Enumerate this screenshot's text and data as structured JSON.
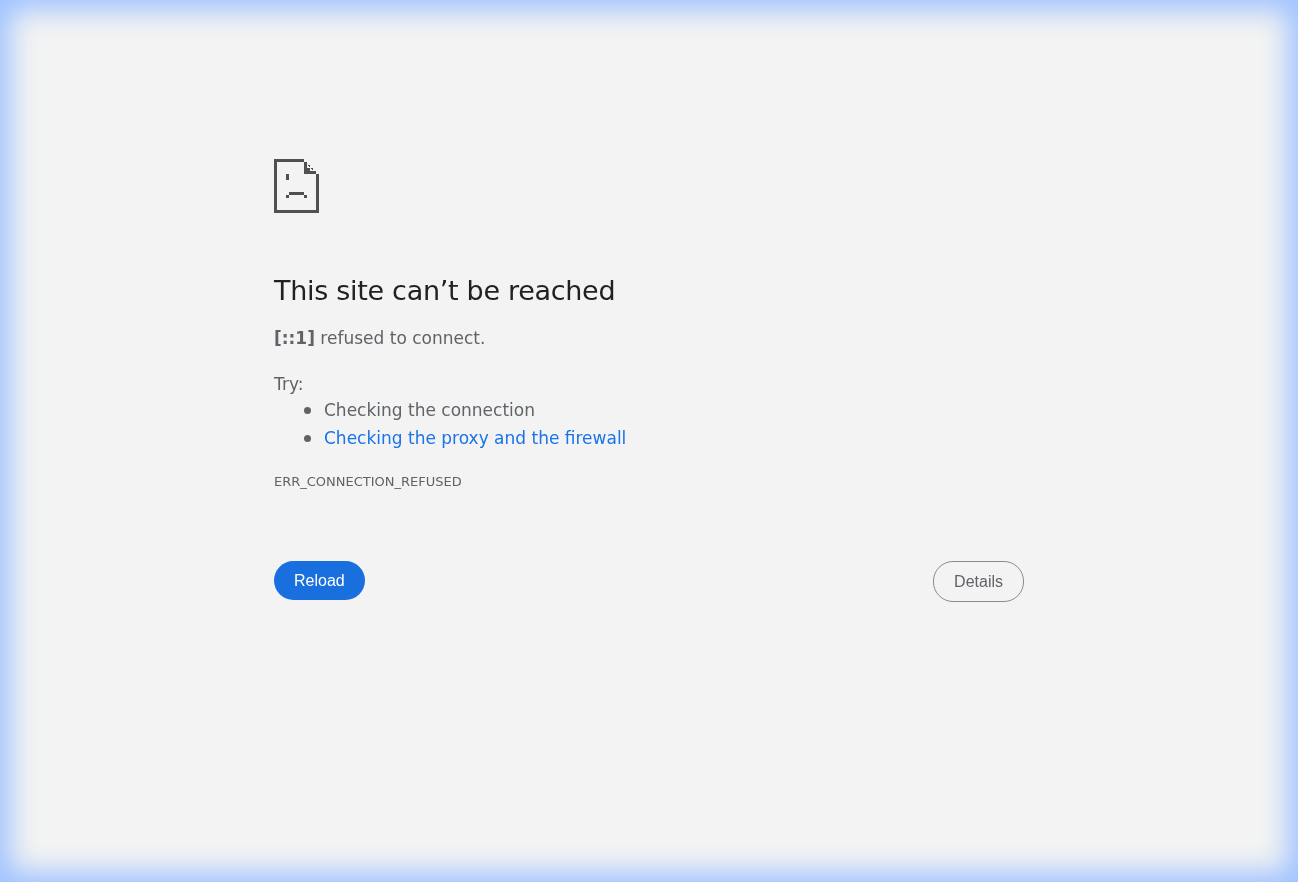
{
  "heading": "This site can’t be reached",
  "message": "**[::1]** refused to connect.",
  "try_label": "Try:",
  "suggestions": [
    {
      "kind": "text",
      "label": "Checking the connection"
    },
    {
      "kind": "link",
      "label": "Checking the proxy and the firewall"
    }
  ],
  "error_code": "ERR_CONNECTION_REFUSED",
  "buttons": [
    {
      "kind": "primary",
      "label": "Reload"
    },
    {
      "kind": "secondary",
      "label": "Details"
    }
  ]
}
